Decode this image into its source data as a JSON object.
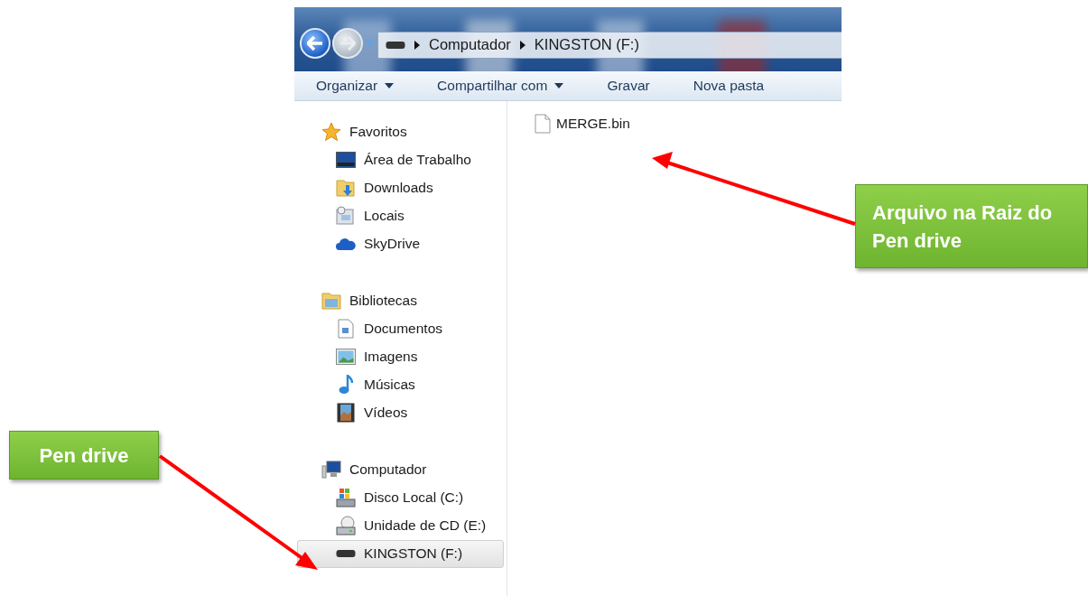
{
  "window": {
    "address": [
      "Computador",
      "KINGSTON (F:)"
    ]
  },
  "toolbar": [
    {
      "label": "Organizar",
      "dropdown": true
    },
    {
      "label": "Compartilhar com",
      "dropdown": true
    },
    {
      "label": "Gravar",
      "dropdown": false
    },
    {
      "label": "Nova pasta",
      "dropdown": false
    }
  ],
  "sidebar": {
    "groups": [
      {
        "label": "Favoritos",
        "kind": "star",
        "children": [
          {
            "label": "Área de Trabalho",
            "kind": "desktop",
            "selected": false
          },
          {
            "label": "Downloads",
            "kind": "downloads",
            "selected": false
          },
          {
            "label": "Locais",
            "kind": "places",
            "selected": false
          },
          {
            "label": "SkyDrive",
            "kind": "cloud",
            "selected": false
          }
        ]
      },
      {
        "label": "Bibliotecas",
        "kind": "libraries",
        "children": [
          {
            "label": "Documentos",
            "kind": "documents",
            "selected": false
          },
          {
            "label": "Imagens",
            "kind": "images",
            "selected": false
          },
          {
            "label": "Músicas",
            "kind": "music",
            "selected": false
          },
          {
            "label": "Vídeos",
            "kind": "videos",
            "selected": false
          }
        ]
      },
      {
        "label": "Computador",
        "kind": "computer",
        "children": [
          {
            "label": "Disco Local (C:)",
            "kind": "disk",
            "selected": false
          },
          {
            "label": "Unidade de CD (E:)",
            "kind": "cd",
            "selected": false
          },
          {
            "label": "KINGSTON (F:)",
            "kind": "usb",
            "selected": true
          }
        ]
      }
    ]
  },
  "files": [
    {
      "name": "MERGE.bin"
    }
  ],
  "callouts": [
    {
      "text": "Pen drive"
    },
    {
      "text": "Arquivo na Raiz do Pen drive"
    }
  ]
}
